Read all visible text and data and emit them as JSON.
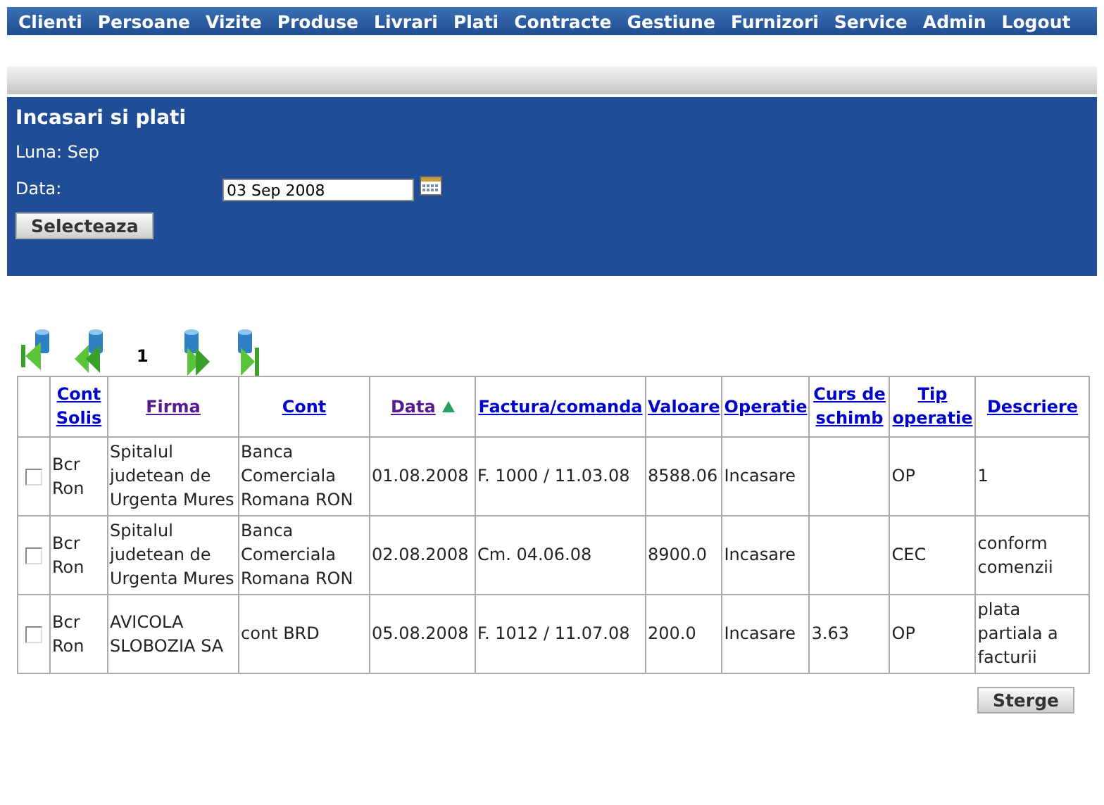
{
  "menu": [
    {
      "label": "Clienti"
    },
    {
      "label": "Persoane"
    },
    {
      "label": "Vizite"
    },
    {
      "label": "Produse"
    },
    {
      "label": "Livrari"
    },
    {
      "label": "Plati"
    },
    {
      "label": "Contracte"
    },
    {
      "label": "Gestiune"
    },
    {
      "label": "Furnizori"
    },
    {
      "label": "Service"
    },
    {
      "label": "Admin"
    },
    {
      "label": "Logout"
    }
  ],
  "panel": {
    "title": "Incasari si plati",
    "month_label": "Luna: Sep",
    "date_label": "Data:",
    "date_value": "03 Sep 2008",
    "select_button": "Selecteaza"
  },
  "pager": {
    "page": "1"
  },
  "table": {
    "columns": [
      {
        "label": "Cont Solis",
        "visited": false,
        "sorted": false
      },
      {
        "label": "Firma",
        "visited": true,
        "sorted": false
      },
      {
        "label": "Cont",
        "visited": false,
        "sorted": false
      },
      {
        "label": "Data",
        "visited": true,
        "sorted": true
      },
      {
        "label": "Factura/comanda",
        "visited": false,
        "sorted": false
      },
      {
        "label": "Valoare",
        "visited": false,
        "sorted": false
      },
      {
        "label": "Operatie",
        "visited": false,
        "sorted": false
      },
      {
        "label": "Curs de schimb",
        "visited": false,
        "sorted": false
      },
      {
        "label": "Tip operatie",
        "visited": false,
        "sorted": false
      },
      {
        "label": "Descriere",
        "visited": false,
        "sorted": false
      }
    ],
    "rows": [
      {
        "checked": false,
        "cells": [
          "Bcr Ron",
          "Spitalul judetean de Urgenta Mures",
          "Banca Comerciala Romana RON",
          "01.08.2008",
          "F. 1000 / 11.03.08",
          "8588.06",
          "Incasare",
          "",
          "OP",
          "1"
        ]
      },
      {
        "checked": false,
        "cells": [
          "Bcr Ron",
          "Spitalul judetean de Urgenta Mures",
          "Banca Comerciala Romana RON",
          "02.08.2008",
          "Cm. 04.06.08",
          "8900.0",
          "Incasare",
          "",
          "CEC",
          "conform comenzii"
        ]
      },
      {
        "checked": false,
        "cells": [
          "Bcr Ron",
          "AVICOLA SLOBOZIA SA",
          "cont BRD",
          "05.08.2008",
          "F. 1012 / 11.07.08",
          "200.0",
          "Incasare",
          "3.63",
          "OP",
          "plata partiala a facturii"
        ]
      }
    ]
  },
  "delete_button": "Sterge"
}
